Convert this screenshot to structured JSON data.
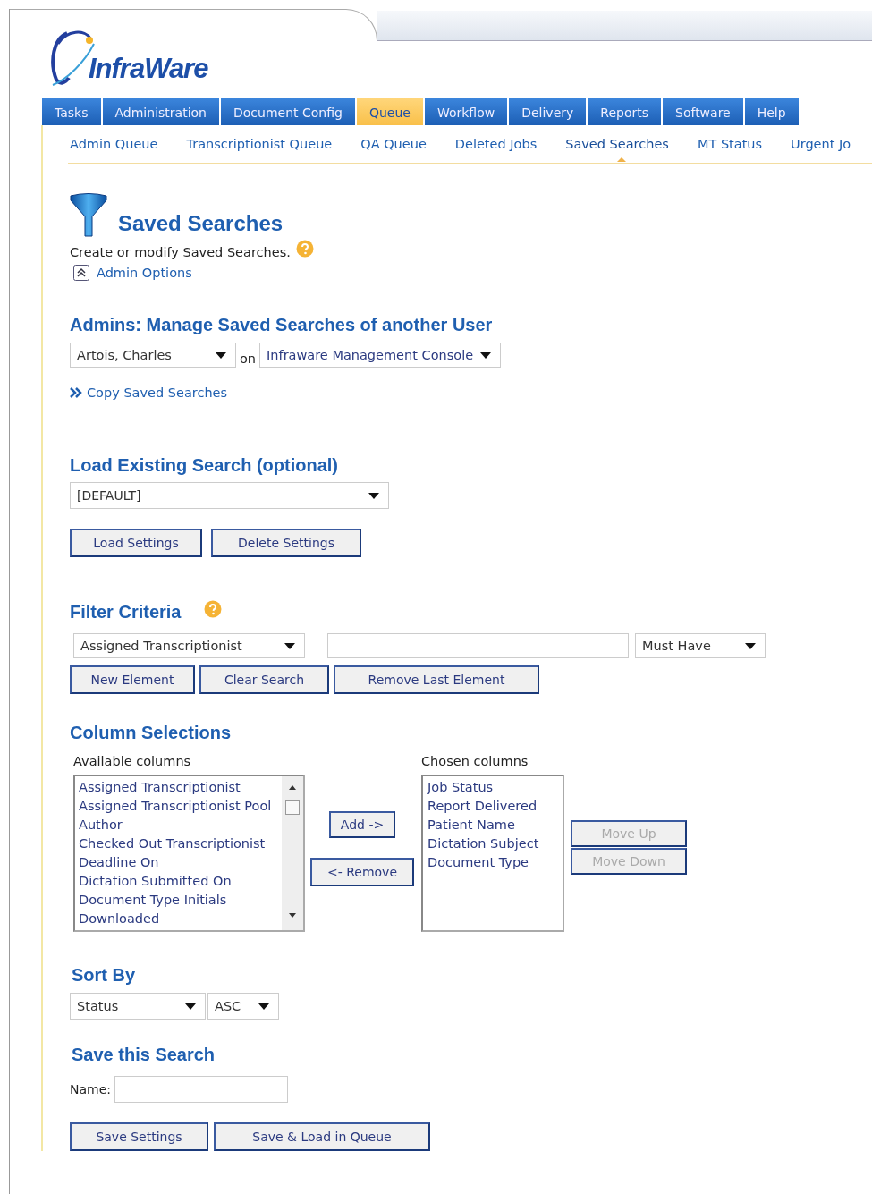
{
  "logo": {
    "text": "InfraWare"
  },
  "main_tabs": [
    {
      "label": "Tasks",
      "selected": false
    },
    {
      "label": "Administration",
      "selected": false
    },
    {
      "label": "Document Config",
      "selected": false
    },
    {
      "label": "Queue",
      "selected": true
    },
    {
      "label": "Workflow",
      "selected": false
    },
    {
      "label": "Delivery",
      "selected": false
    },
    {
      "label": "Reports",
      "selected": false
    },
    {
      "label": "Software",
      "selected": false
    },
    {
      "label": "Help",
      "selected": false
    }
  ],
  "sub_tabs": [
    {
      "label": "Admin Queue",
      "selected": false
    },
    {
      "label": "Transcriptionist Queue",
      "selected": false
    },
    {
      "label": "QA Queue",
      "selected": false
    },
    {
      "label": "Deleted Jobs",
      "selected": false
    },
    {
      "label": "Saved Searches",
      "selected": true
    },
    {
      "label": "MT Status",
      "selected": false
    },
    {
      "label": "Urgent Jo",
      "selected": false
    }
  ],
  "page": {
    "title": "Saved Searches",
    "description": "Create or modify Saved Searches.",
    "admin_options_link": "Admin Options"
  },
  "admin_section": {
    "heading": "Admins: Manage Saved Searches of another User",
    "user_select": "Artois, Charles",
    "joiner": "on",
    "app_select": "Infraware Management Console",
    "copy_link": "Copy Saved Searches"
  },
  "load_section": {
    "heading": "Load Existing Search (optional)",
    "search_select": "[DEFAULT]",
    "buttons": [
      "Load Settings",
      "Delete Settings"
    ]
  },
  "filter_section": {
    "heading": "Filter Criteria",
    "field_select": "Assigned Transcriptionist",
    "condition_select": "Must Have",
    "buttons": [
      "New Element",
      "Clear Search",
      "Remove Last Element"
    ]
  },
  "column_section": {
    "heading": "Column Selections",
    "available_label": "Available columns",
    "available": [
      "Assigned Transcriptionist",
      "Assigned Transcriptionist Pool",
      "Author",
      "Checked Out Transcriptionist",
      "Deadline On",
      "Dictation Submitted On",
      "Document Type Initials",
      "Downloaded"
    ],
    "add_button": "Add ->",
    "remove_button": "<- Remove",
    "chosen_label": "Chosen columns",
    "chosen": [
      "Job Status",
      "Report Delivered",
      "Patient Name",
      "Dictation Subject",
      "Document Type"
    ],
    "move_buttons": [
      {
        "label": "Move Up",
        "disabled": true
      },
      {
        "label": "Move Down",
        "disabled": true
      }
    ]
  },
  "sort_section": {
    "heading": "Sort By",
    "field_select": "Status",
    "order_select": "ASC"
  },
  "save_section": {
    "heading": "Save this Search",
    "name_label": "Name:",
    "buttons": [
      "Save Settings",
      "Save & Load in Queue"
    ]
  }
}
